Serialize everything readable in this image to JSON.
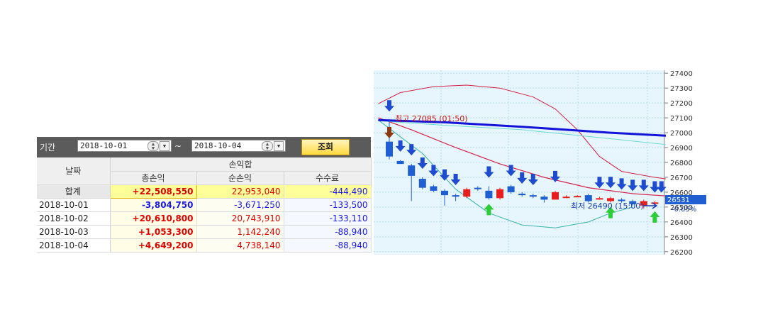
{
  "filter": {
    "period_label": "기간",
    "date_from": "2018-10-01",
    "date_to": "2018-10-04",
    "separator": "~",
    "search_label": "조회"
  },
  "table": {
    "date_header": "날짜",
    "group_header": "손익합",
    "columns": [
      "총손익",
      "순손익",
      "수수료"
    ],
    "total_row": {
      "label": "합계",
      "gross": "+22,508,550",
      "net": "22,953,040",
      "fee": "-444,490"
    },
    "rows": [
      {
        "date": "2018-10-01",
        "gross": "-3,804,750",
        "net": "-3,671,250",
        "fee": "-133,500"
      },
      {
        "date": "2018-10-02",
        "gross": "+20,610,800",
        "net": "20,743,910",
        "fee": "-133,110"
      },
      {
        "date": "2018-10-03",
        "gross": "+1,053,300",
        "net": "1,142,240",
        "fee": "-88,940"
      },
      {
        "date": "2018-10-04",
        "gross": "+4,649,200",
        "net": "4,738,140",
        "fee": "-88,940"
      }
    ]
  },
  "chart": {
    "high_label": "최고 27085 (01:50)",
    "low_label": "최저 26490 (15:00)",
    "current_price": "26531",
    "current_change": "-0.05%",
    "y_ticks": [
      "27400",
      "27300",
      "27200",
      "27100",
      "27000",
      "26900",
      "26800",
      "26700",
      "26600",
      "26500",
      "26400",
      "26300",
      "26200"
    ],
    "colors": {
      "up": "#e81e1e",
      "down": "#1f5fd1",
      "background": "#e6f6fc",
      "ma_long": "#1414d8",
      "ma_mid": "#6fd9d0",
      "band": "#d62048"
    }
  },
  "chart_data": {
    "type": "candlestick",
    "ylim": [
      26180,
      27420
    ],
    "candles": [
      {
        "o": 26940,
        "c": 26840,
        "h": 27085,
        "l": 26820
      },
      {
        "o": 26810,
        "c": 26790,
        "h": 26815,
        "l": 26790
      },
      {
        "o": 26780,
        "c": 26710,
        "h": 26790,
        "l": 26540
      },
      {
        "o": 26690,
        "c": 26630,
        "h": 26700,
        "l": 26620
      },
      {
        "o": 26640,
        "c": 26610,
        "h": 26650,
        "l": 26600
      },
      {
        "o": 26610,
        "c": 26580,
        "h": 26620,
        "l": 26510
      },
      {
        "o": 26580,
        "c": 26570,
        "h": 26590,
        "l": 26540
      },
      {
        "o": 26570,
        "c": 26620,
        "h": 26630,
        "l": 26560
      },
      {
        "o": 26630,
        "c": 26620,
        "h": 26640,
        "l": 26610
      },
      {
        "o": 26610,
        "c": 26560,
        "h": 26640,
        "l": 26550
      },
      {
        "o": 26560,
        "c": 26620,
        "h": 26630,
        "l": 26550
      },
      {
        "o": 26640,
        "c": 26600,
        "h": 26650,
        "l": 26590
      },
      {
        "o": 26590,
        "c": 26580,
        "h": 26600,
        "l": 26570
      },
      {
        "o": 26580,
        "c": 26570,
        "h": 26590,
        "l": 26560
      },
      {
        "o": 26570,
        "c": 26550,
        "h": 26580,
        "l": 26530
      },
      {
        "o": 26550,
        "c": 26600,
        "h": 26610,
        "l": 26550
      },
      {
        "o": 26570,
        "c": 26570,
        "h": 26580,
        "l": 26560
      },
      {
        "o": 26575,
        "c": 26575,
        "h": 26580,
        "l": 26570
      },
      {
        "o": 26580,
        "c": 26540,
        "h": 26590,
        "l": 26530
      },
      {
        "o": 26560,
        "c": 26560,
        "h": 26570,
        "l": 26550
      },
      {
        "o": 26540,
        "c": 26560,
        "h": 26570,
        "l": 26530
      },
      {
        "o": 26550,
        "c": 26540,
        "h": 26560,
        "l": 26530
      },
      {
        "o": 26540,
        "c": 26520,
        "h": 26550,
        "l": 26510
      },
      {
        "o": 26510,
        "c": 26540,
        "h": 26550,
        "l": 26490
      },
      {
        "o": 26530,
        "c": 26531,
        "h": 26540,
        "l": 26500
      }
    ],
    "down_arrows": [
      0,
      1,
      2,
      3,
      4,
      5,
      6,
      9,
      11,
      12,
      13,
      15,
      19,
      20,
      21,
      22,
      23,
      24,
      25
    ],
    "up_arrows": [
      9,
      20,
      24
    ]
  }
}
